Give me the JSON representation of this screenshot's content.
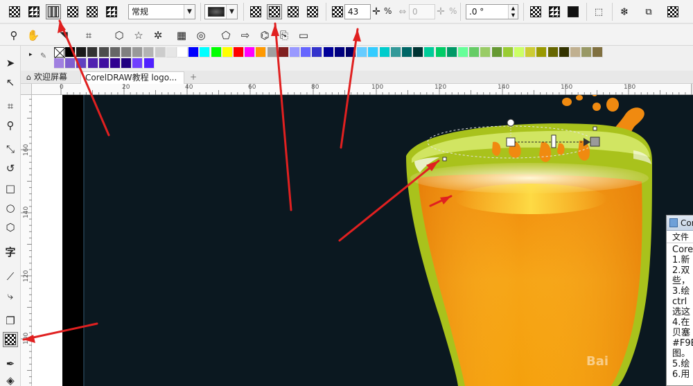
{
  "property_bar": {
    "preset_value": "常规",
    "transparency_value": "43",
    "transparency_unit": "%",
    "second_value": "0",
    "second_unit": "%",
    "angle_value": ".0 °"
  },
  "tabs": [
    {
      "label": "欢迎屏幕"
    },
    {
      "label": "CorelDRAW教程 logo..."
    }
  ],
  "ruler": {
    "h_labels": [
      "0",
      "20",
      "40",
      "60",
      "80",
      "100",
      "120",
      "140",
      "160",
      "180"
    ],
    "v_labels": [
      "160",
      "140",
      "120",
      "100"
    ]
  },
  "docker": {
    "title": "Cor",
    "menu": "文件",
    "lines": [
      "Core",
      "1.新",
      "2.双",
      "些，",
      "3.绘",
      "ctrl",
      "选这",
      "4.在",
      "贝塞",
      "#F9B",
      "图。",
      "5.绘",
      "6.用"
    ]
  },
  "watermark": "Bai",
  "colors": {
    "canvas_bg": "#0b1820",
    "glass_rim": "#a9c21c",
    "juice": "#f4a010",
    "annotation": "#e02020"
  },
  "palette": [
    "#000000",
    "#1a1a1a",
    "#333333",
    "#4d4d4d",
    "#666666",
    "#808080",
    "#999999",
    "#b3b3b3",
    "#cccccc",
    "#e6e6e6",
    "#ffffff",
    "#0000ff",
    "#00ffff",
    "#00ff00",
    "#ffff00",
    "#ff0000",
    "#ff00ff",
    "#ff9900",
    "#a0a0a0",
    "#7f1f1f",
    "#9999ff",
    "#6666ff",
    "#3333cc",
    "#000099",
    "#00007f",
    "#000066",
    "#66ccff",
    "#33ccff",
    "#00cccc",
    "#339999",
    "#006666",
    "#003333",
    "#00cc99",
    "#00cc66",
    "#009966",
    "#66ff99",
    "#66cc66",
    "#99cc66",
    "#669933",
    "#99cc33",
    "#ccff66",
    "#cccc33",
    "#999900",
    "#666600",
    "#333300",
    "#c0b090",
    "#999966",
    "#807040"
  ],
  "palette_row2": [
    "#a080e0",
    "#8060d0",
    "#6040c0",
    "#5020b0",
    "#4010a0",
    "#300090",
    "#200080",
    "#7040ff",
    "#5020ff"
  ]
}
